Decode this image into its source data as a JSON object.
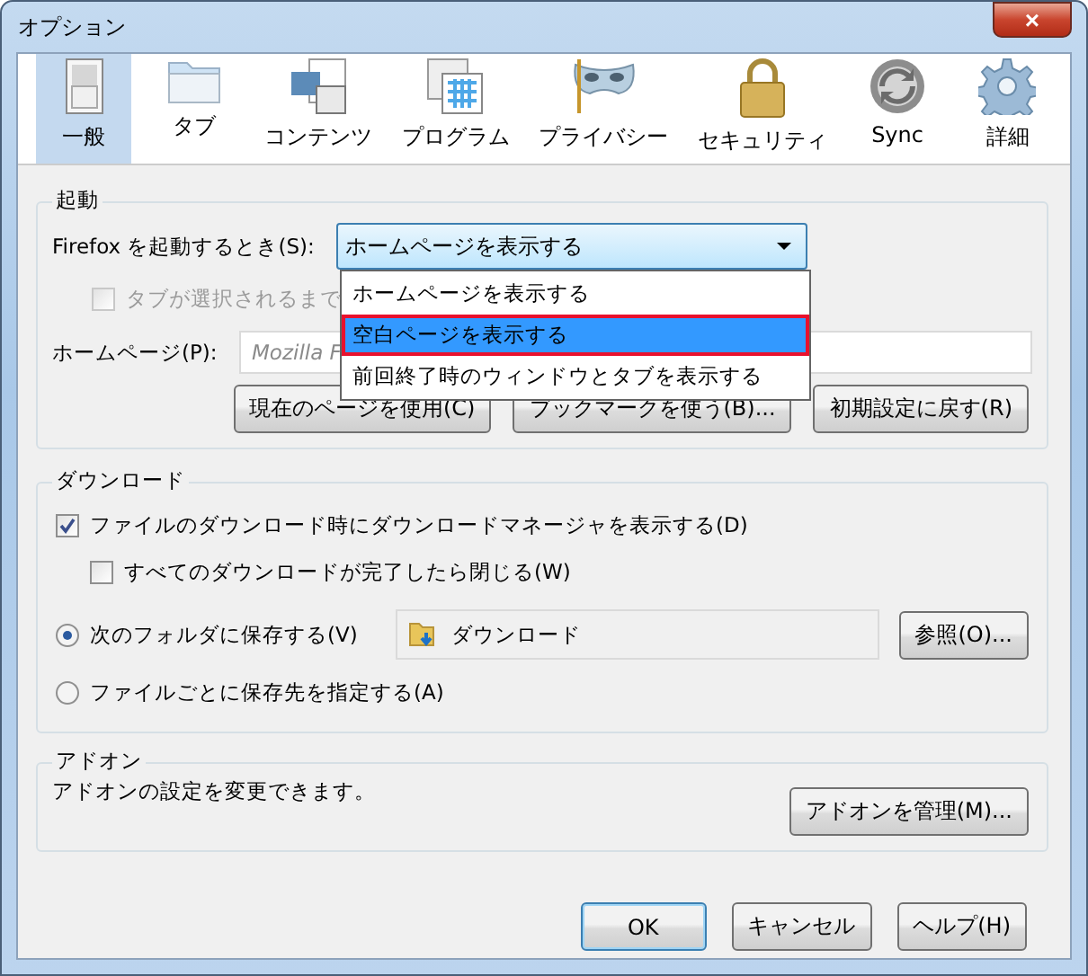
{
  "window": {
    "title": "オプション",
    "close": "×"
  },
  "tabs": [
    {
      "label": "一般",
      "selected": true
    },
    {
      "label": "タブ",
      "selected": false
    },
    {
      "label": "コンテンツ",
      "selected": false
    },
    {
      "label": "プログラム",
      "selected": false
    },
    {
      "label": "プライバシー",
      "selected": false
    },
    {
      "label": "セキュリティ",
      "selected": false
    },
    {
      "label": "Sync",
      "selected": false
    },
    {
      "label": "詳細",
      "selected": false
    }
  ],
  "startup": {
    "title": "起動",
    "startup_label": "Firefox を起動するとき(S):",
    "startup_select": {
      "value": "ホームページを表示する",
      "expanded": true
    },
    "options": [
      {
        "label": "ホームページを表示する",
        "selected": false
      },
      {
        "label": "空白ページを表示する",
        "selected": true
      },
      {
        "label": "前回終了時のウィンドウとタブを表示する",
        "selected": false
      }
    ],
    "tab_checkbox": {
      "label": "タブが選択されるまで",
      "checked": false,
      "disabled": true
    },
    "homepage_label": "ホームページ(P):",
    "homepage_value": "Mozilla F",
    "buttons": [
      "現在のページを使用(C)",
      "ブックマークを使う(B)...",
      "初期設定に戻す(R)"
    ]
  },
  "downloads": {
    "title": "ダウンロード",
    "show_manager": {
      "label": "ファイルのダウンロード時にダウンロードマネージャを表示する(D)",
      "checked": true
    },
    "close_when_done": {
      "label": "すべてのダウンロードが完了したら閉じる(W)",
      "checked": false
    },
    "save_folder": {
      "label": "次のフォルダに保存する(V)",
      "selected": true,
      "folder": "ダウンロード",
      "browse": "参照(O)..."
    },
    "ask_each": {
      "label": "ファイルごとに保存先を指定する(A)",
      "selected": false
    }
  },
  "addons": {
    "title": "アドオン",
    "description": "アドオンの設定を変更できます。",
    "button": "アドオンを管理(M)..."
  },
  "footer": [
    {
      "label": "OK",
      "default": true
    },
    {
      "label": "キャンセル",
      "default": false
    },
    {
      "label": "ヘルプ(H)",
      "default": false
    }
  ]
}
